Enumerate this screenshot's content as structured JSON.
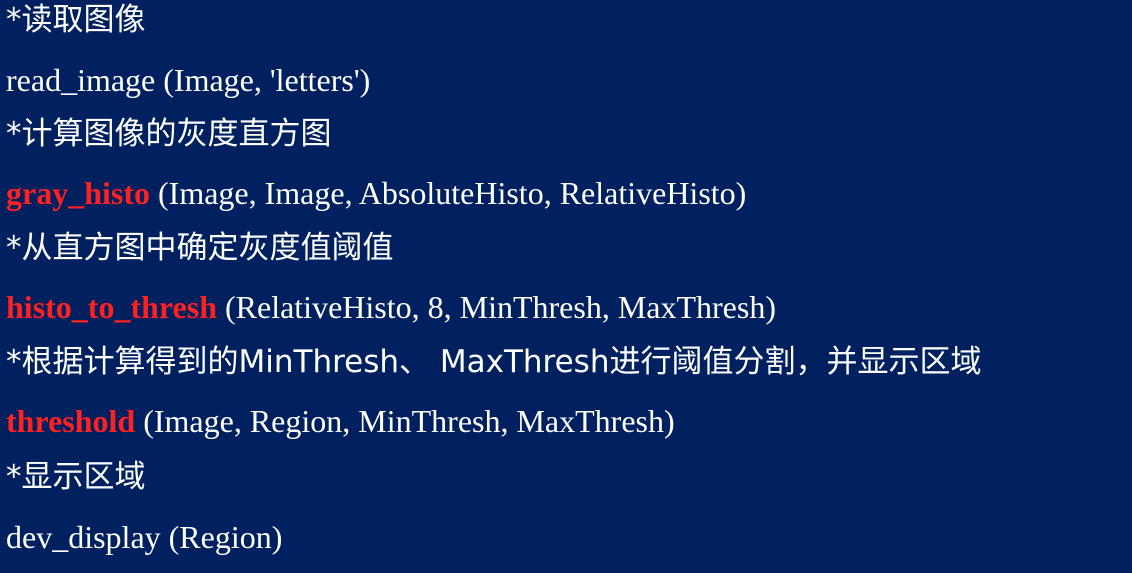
{
  "lines": [
    {
      "type": "comment",
      "text": "*读取图像"
    },
    {
      "type": "code",
      "plain": "read_image (Image, 'letters')"
    },
    {
      "type": "comment",
      "text": "*计算图像的灰度直方图"
    },
    {
      "type": "code",
      "fn": "gray_histo",
      "args": " (Image, Image, AbsoluteHisto, RelativeHisto)"
    },
    {
      "type": "comment",
      "text": "*从直方图中确定灰度值阈值"
    },
    {
      "type": "code",
      "fn": "histo_to_thresh",
      "args": " (RelativeHisto, 8, MinThresh, MaxThresh)"
    },
    {
      "type": "comment",
      "text": "*根据计算得到的MinThresh、 MaxThresh进行阈值分割，并显示区域"
    },
    {
      "type": "code",
      "fn": "threshold",
      "args": " (Image, Region, MinThresh, MaxThresh)"
    },
    {
      "type": "comment",
      "text": "*显示区域"
    },
    {
      "type": "code",
      "plain": "dev_display (Region)"
    }
  ],
  "colors": {
    "background": "#002060",
    "text": "#ffffff",
    "highlight": "#ff2020"
  }
}
